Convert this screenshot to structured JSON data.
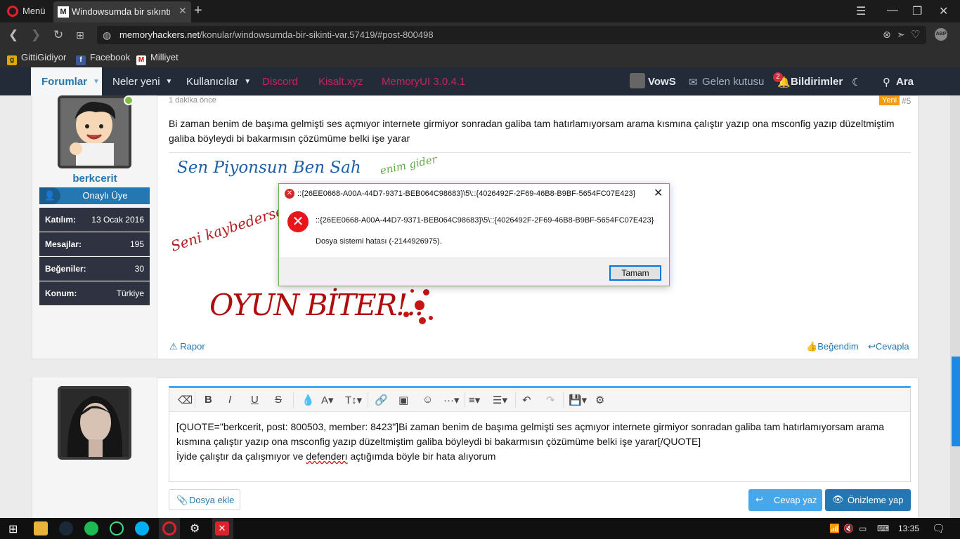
{
  "browser": {
    "menu_label": "Menü",
    "tab_title": "Windowsumda bir sıkıntı v",
    "tab_favicon": "M",
    "url_domain": "memoryhackers.net",
    "url_path": "/konular/windowsumda-bir-sikinti-var.57419/#post-800498",
    "abp": "ABP",
    "bookmarks": [
      "GittiGidiyor",
      "Facebook",
      "Milliyet"
    ]
  },
  "site_nav": {
    "items": [
      "Forumlar",
      "Neler yeni",
      "Kullanıcılar",
      "Discord",
      "Kisalt.xyz",
      "MemoryUI 3.0.4.1"
    ],
    "user": "VowS",
    "inbox": "Gelen kutusu",
    "alerts": "Bildirimler",
    "alerts_count": "2",
    "search": "Ara"
  },
  "post": {
    "time": "1 dakika önce",
    "new_badge": "Yeni",
    "number": "#5",
    "username": "berkcerit",
    "user_title": "Onaylı Üye",
    "stats": [
      {
        "label": "Katılım:",
        "value": "13 Ocak 2016"
      },
      {
        "label": "Mesajlar:",
        "value": "195"
      },
      {
        "label": "Beğeniler:",
        "value": "30"
      },
      {
        "label": "Konum:",
        "value": "Türkiye"
      }
    ],
    "message": "Bi zaman benim de başıma gelmişti ses açmıyor internete girmiyor sonradan galiba tam hatırlamıyorsam arama kısmına çalıştır yazıp ona msconfig yazıp düzeltmiştim galiba böyleydi bi bakarmısın çözümüme belki işe yarar",
    "signature": {
      "line1": "Sen Piyonsun Ben Sah",
      "line2": "enim gider",
      "line3": "Seni kaybedersem",
      "line4": "OYUN BİTER!.."
    },
    "report": "Rapor",
    "like": "Beğendim",
    "reply": "Cevapla"
  },
  "dialog": {
    "title": "::{26EE0668-A00A-44D7-9371-BEB064C98683}\\5\\::{4026492F-2F69-46B8-B9BF-5654FC07E423}",
    "message1": "::{26EE0668-A00A-44D7-9371-BEB064C98683}\\5\\::{4026492F-2F69-46B8-B9BF-5654FC07E423}",
    "message2": "Dosya sistemi hatası (-2144926975).",
    "ok": "Tamam"
  },
  "editor": {
    "line1": "[QUOTE=\"berkcerit, post: 800503, member: 8423\"]Bi zaman benim de başıma gelmişti ses açmıyor internete girmiyor sonradan galiba tam hatırlamıyorsam arama kısmına çalıştır yazıp ona msconfig yazıp düzeltmiştim galiba böyleydi bi bakarmısın çözümüme belki işe yarar[/QUOTE]",
    "line2a": "İyide çalıştır da çalışmıyor ve ",
    "line2b": "defenderı",
    "line2c": " açtığımda böyle bir hata alıyorum",
    "attach": "Dosya ekle",
    "reply": "Cevap yaz",
    "preview": "Önizleme yap"
  },
  "taskbar": {
    "time": "13:35"
  },
  "colors": {
    "nav_bg": "#222b37",
    "accent_blue": "#2577b1",
    "pink_links": "#c3265d",
    "dialog_border": "#6ab344"
  }
}
